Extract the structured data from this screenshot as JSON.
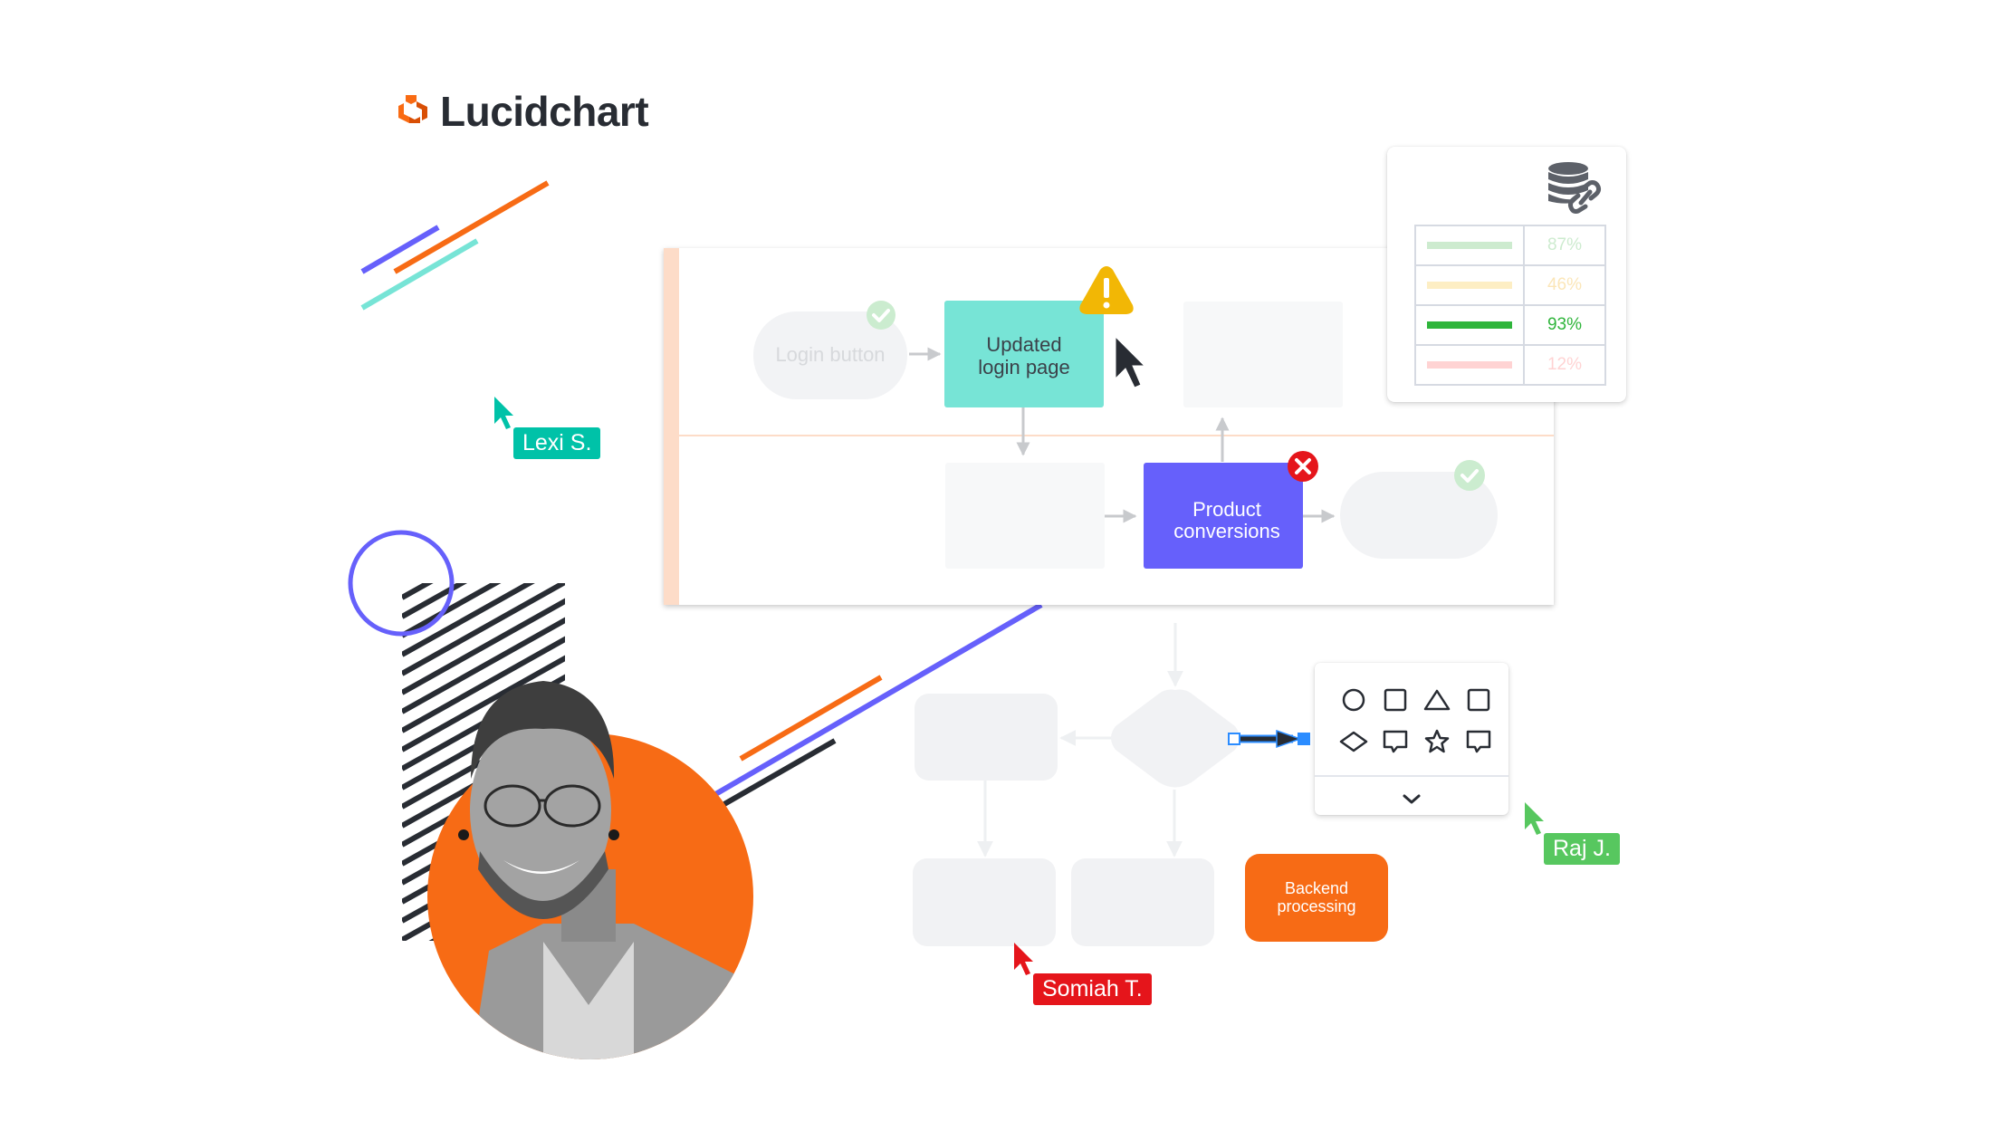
{
  "brand": {
    "name": "Lucidchart",
    "logo_icon": "lucid-cube-logo-icon",
    "logo_color": "#f96b13"
  },
  "colors": {
    "orange": "#f76b15",
    "purple": "#6660fb",
    "teal": "#77e4d6",
    "dark": "#282c33",
    "lane_accent": "#fddcc8",
    "node_gray": "#f1f2f4",
    "connector": "#c8cacd",
    "success_green": "#cbeccf",
    "warning_yellow": "#f2b705",
    "error_red": "#e5151b",
    "selection_blue": "#2b8cff"
  },
  "swimlane": {
    "lanes": [
      {
        "nodes": [
          {
            "id": "login-button",
            "label": "Login button",
            "shape": "pill",
            "status": "success-check-icon"
          },
          {
            "id": "updated-login-page",
            "label_lines": [
              "Updated",
              "login page"
            ],
            "shape": "rect",
            "color": "#77e4d6",
            "status": "warning-triangle-icon"
          },
          {
            "id": "top-placeholder",
            "label": "",
            "shape": "rect"
          }
        ]
      },
      {
        "nodes": [
          {
            "id": "bottom-placeholder",
            "label": "",
            "shape": "rect"
          },
          {
            "id": "product-conversions",
            "label_lines": [
              "Product",
              "conversions"
            ],
            "shape": "rect",
            "color": "#6660fb",
            "status": "error-x-icon"
          },
          {
            "id": "bottom-end-pill",
            "label": "",
            "shape": "pill",
            "status": "success-check-icon"
          }
        ]
      }
    ]
  },
  "flowchart": {
    "nodes": [
      {
        "id": "decision",
        "label": "",
        "shape": "diamond"
      },
      {
        "id": "left-box",
        "label": "",
        "shape": "rounded-rect"
      },
      {
        "id": "bottom-left-box",
        "label": "",
        "shape": "rounded-rect"
      },
      {
        "id": "bottom-middle-box",
        "label": "",
        "shape": "rounded-rect"
      },
      {
        "id": "backend-processing",
        "label_lines": [
          "Backend",
          "processing"
        ],
        "shape": "rounded-rect",
        "color": "#f76b15"
      }
    ]
  },
  "data_panel": {
    "icon": "database-link-icon",
    "rows": [
      {
        "value": "87%",
        "fraction": 0.87,
        "bar_color": "#cdebcf",
        "text_color": "#cdebcf"
      },
      {
        "value": "46%",
        "fraction": 0.46,
        "bar_color": "#fdeec4",
        "text_color": "#fbe6b8"
      },
      {
        "value": "93%",
        "fraction": 0.93,
        "bar_color": "#2fb53b",
        "text_color": "#2fb53b"
      },
      {
        "value": "12%",
        "fraction": 0.12,
        "bar_color": "#ffd3d3",
        "text_color": "#ffd3d3"
      }
    ]
  },
  "shape_palette": {
    "shapes": [
      "circle-shape-icon",
      "square-shape-icon",
      "triangle-shape-icon",
      "square-shape-icon",
      "diamond-shape-icon",
      "speech-bubble-shape-icon",
      "star-shape-icon",
      "speech-bubble-shape-icon"
    ],
    "expand_icon": "chevron-down-icon"
  },
  "collaborators": [
    {
      "name": "Lexi S.",
      "color": "#00c2a8"
    },
    {
      "name": "Raj J.",
      "color": "#57c75f"
    },
    {
      "name": "Somiah T.",
      "color": "#e5151b"
    }
  ],
  "main_cursor": {
    "icon": "mouse-pointer-icon",
    "color": "#282c33"
  },
  "avatar": {
    "description": "smiling man with glasses and beard, grayscale portrait on orange circle"
  }
}
